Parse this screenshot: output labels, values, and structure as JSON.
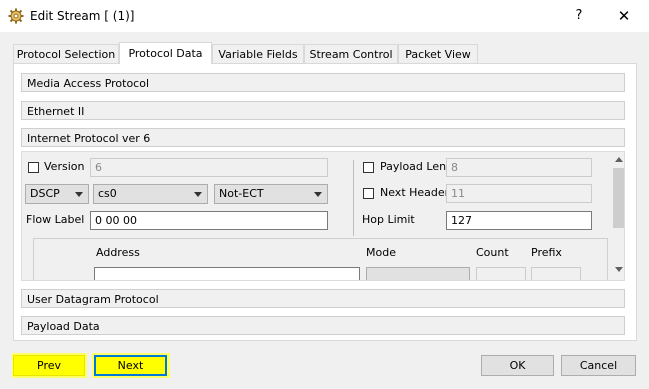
{
  "window": {
    "title": "Edit Stream [ (1)]",
    "help": "?",
    "close": "✕"
  },
  "tabs": [
    {
      "label": "Protocol Selection",
      "active": false
    },
    {
      "label": "Protocol Data",
      "active": true
    },
    {
      "label": "Variable Fields",
      "active": false
    },
    {
      "label": "Stream Control",
      "active": false
    },
    {
      "label": "Packet View",
      "active": false
    }
  ],
  "sections": {
    "mac": "Media Access Protocol",
    "ethernet": "Ethernet II",
    "ipv6": "Internet Protocol ver 6",
    "udp": "User Datagram Protocol",
    "payload": "Payload Data"
  },
  "ipv6": {
    "version_label": "Version",
    "version_value": "6",
    "dscp_combo": "DSCP",
    "cs_combo": "cs0",
    "ecn_combo": "Not-ECT",
    "flow_label_label": "Flow Label",
    "flow_label_value": "0 00 00",
    "payload_length_label": "Payload Length",
    "payload_length_value": "8",
    "next_header_label": "Next Header",
    "next_header_value": "11",
    "hop_limit_label": "Hop Limit",
    "hop_limit_value": "127",
    "addr_header": {
      "address": "Address",
      "mode": "Mode",
      "count": "Count",
      "prefix": "Prefix"
    }
  },
  "buttons": {
    "prev": "Prev",
    "next": "Next",
    "ok": "OK",
    "cancel": "Cancel"
  },
  "colors": {
    "highlight": "#ffff00",
    "focus": "#0078d7"
  }
}
